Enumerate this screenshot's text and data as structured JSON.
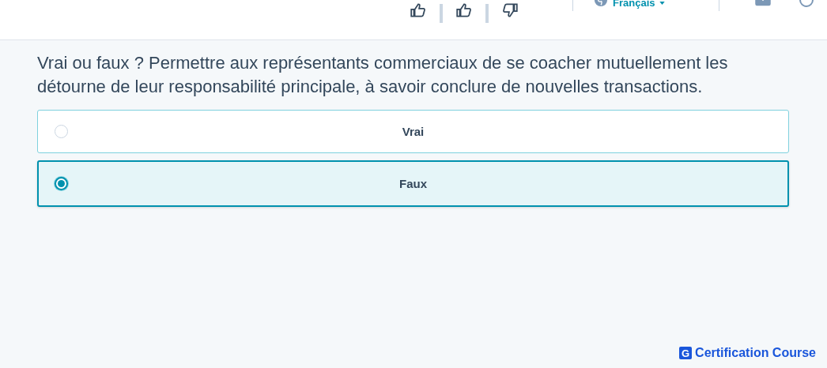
{
  "header": {
    "language": "Français"
  },
  "question": "Vrai ou faux ? Permettre aux représentants commerciaux de se coacher mutuellement les détourne de leur responsabilité principale, à savoir conclure de nouvelles transactions.",
  "options": [
    {
      "label": "Vrai",
      "selected": false
    },
    {
      "label": "Faux",
      "selected": true
    }
  ],
  "brand": {
    "letter": "G",
    "name": "Certification Course"
  }
}
